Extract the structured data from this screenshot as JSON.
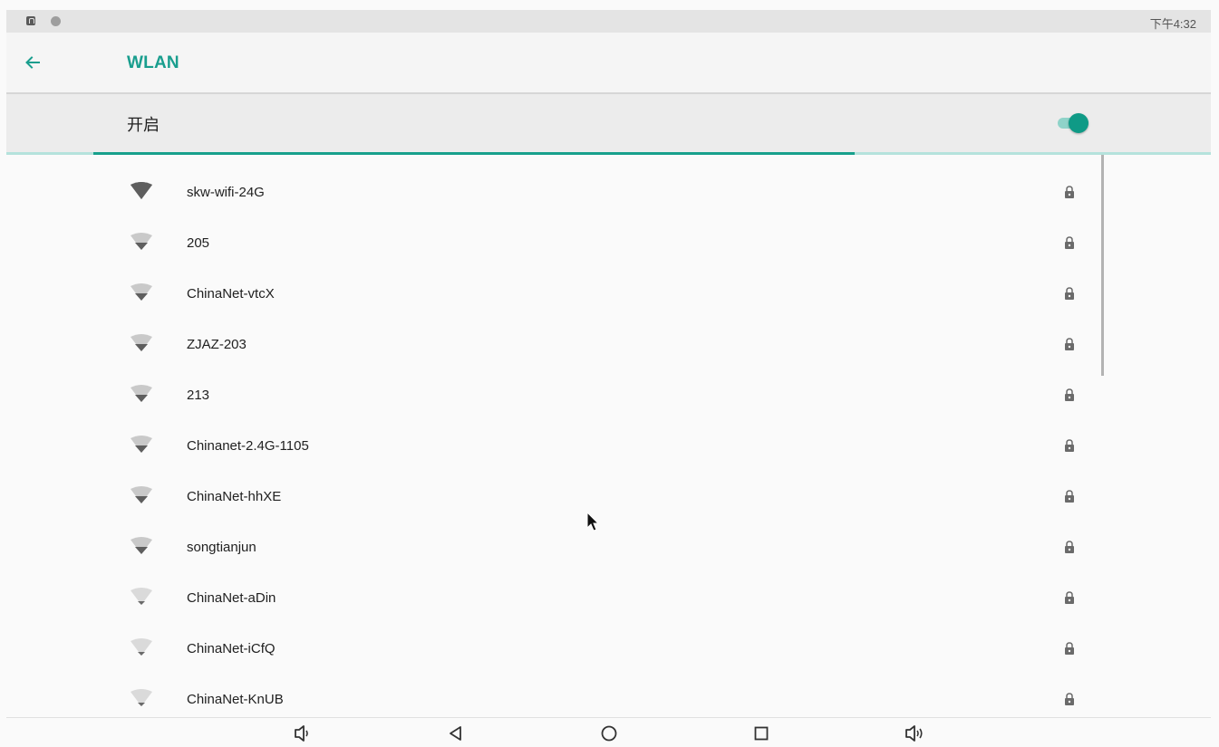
{
  "status_bar": {
    "time": "下午4:32",
    "icons": [
      "notification-a-icon",
      "notification-dot-icon"
    ]
  },
  "app_bar": {
    "title": "WLAN",
    "back_icon": "arrow-back-icon"
  },
  "wifi_switch": {
    "label": "开启",
    "enabled": true
  },
  "scan_progress": {
    "fraction": 0.68
  },
  "colors": {
    "accent": "#199e8e",
    "toggle_thumb": "#0f9a86",
    "toggle_track": "#8fd3c9"
  },
  "networks": [
    {
      "ssid": "skw-wifi-24G",
      "signal": "strong",
      "secured": true
    },
    {
      "ssid": "205",
      "signal": "medium",
      "secured": true
    },
    {
      "ssid": "ChinaNet-vtcX",
      "signal": "medium",
      "secured": true
    },
    {
      "ssid": "ZJAZ-203",
      "signal": "medium",
      "secured": true
    },
    {
      "ssid": "213",
      "signal": "medium",
      "secured": true
    },
    {
      "ssid": "Chinanet-2.4G-1105",
      "signal": "medium",
      "secured": true
    },
    {
      "ssid": "ChinaNet-hhXE",
      "signal": "medium",
      "secured": true
    },
    {
      "ssid": "songtianjun",
      "signal": "medium",
      "secured": true
    },
    {
      "ssid": "ChinaNet-aDin",
      "signal": "weak",
      "secured": true
    },
    {
      "ssid": "ChinaNet-iCfQ",
      "signal": "weak",
      "secured": true
    },
    {
      "ssid": "ChinaNet-KnUB",
      "signal": "weak",
      "secured": true
    }
  ],
  "nav_bar": [
    "volume-down-icon",
    "back-triangle-icon",
    "home-circle-icon",
    "recents-square-icon",
    "volume-up-icon"
  ]
}
